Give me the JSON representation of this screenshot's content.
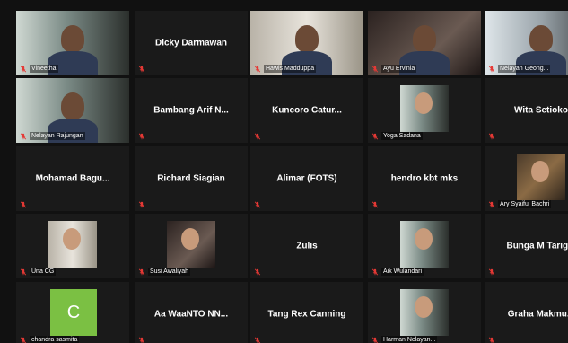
{
  "participants": [
    {
      "name": "Vineetha",
      "kind": "video"
    },
    {
      "name": "Dicky Darmawan",
      "kind": "name"
    },
    {
      "name": "Hawis Madduppa",
      "kind": "video",
      "active": true
    },
    {
      "name": "Ayu Ervinia",
      "kind": "video"
    },
    {
      "name": "Nelayan Geong...",
      "kind": "video"
    },
    {
      "name": "Nelayan Rajungan",
      "kind": "video"
    },
    {
      "name": "Bambang Arif N...",
      "kind": "name"
    },
    {
      "name": "Kuncoro  Catur...",
      "kind": "name"
    },
    {
      "name": "Yoga Sadana",
      "kind": "photo"
    },
    {
      "name": "Wita Setioko",
      "kind": "name"
    },
    {
      "name": "Mohamad  Bagu...",
      "kind": "name"
    },
    {
      "name": "Richard Siagian",
      "kind": "name"
    },
    {
      "name": "Alimar (FOTS)",
      "kind": "name"
    },
    {
      "name": "hendro kbt mks",
      "kind": "name"
    },
    {
      "name": "Ary Syaiful Bachri",
      "kind": "photo"
    },
    {
      "name": "Una CG",
      "kind": "photo"
    },
    {
      "name": "Susi Awaliyah",
      "kind": "photo"
    },
    {
      "name": "Zulis",
      "kind": "name"
    },
    {
      "name": "Aik Wulandari",
      "kind": "photo"
    },
    {
      "name": "Bunga  M  Tarig...",
      "kind": "name"
    },
    {
      "name": "chandra sasmita",
      "kind": "letter",
      "letter": "C"
    },
    {
      "name": "Aa WaaNTO NN...",
      "kind": "name"
    },
    {
      "name": "Tang Rex Canning",
      "kind": "name"
    },
    {
      "name": "Harman Nelayan...",
      "kind": "photo"
    },
    {
      "name": "Graha Makmu...",
      "kind": "name"
    }
  ],
  "colors": {
    "active_border": "#d6e64a",
    "mute_icon": "#e53935",
    "letter_avatar": "#7bc043",
    "tile_bg": "#1a1a1a"
  }
}
